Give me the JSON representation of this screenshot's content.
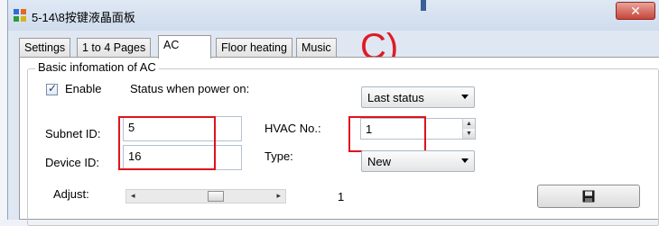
{
  "window": {
    "title": "5-14\\8按键液晶面板"
  },
  "tabs": [
    {
      "label": "Settings"
    },
    {
      "label": "1 to 4 Pages"
    },
    {
      "label": "AC"
    },
    {
      "label": "Floor heating"
    },
    {
      "label": "Music"
    }
  ],
  "annotation": {
    "label": "C)"
  },
  "group": {
    "title": "Basic infomation of AC"
  },
  "enable": {
    "label": "Enable",
    "checked": true
  },
  "status_power_on": {
    "label": "Status when power on:",
    "value": "Last status"
  },
  "subnet": {
    "label": "Subnet ID:",
    "value": "5"
  },
  "device": {
    "label": "Device ID:",
    "value": "16"
  },
  "hvac": {
    "label": "HVAC No.:",
    "value": "1"
  },
  "type": {
    "label": "Type:",
    "value": "New"
  },
  "adjust": {
    "label": "Adjust:",
    "value": "1"
  },
  "colors": {
    "highlight": "#e0121a",
    "annotation": "#e01a25"
  },
  "icons": {
    "save": "save-icon",
    "window": "app-icon"
  }
}
